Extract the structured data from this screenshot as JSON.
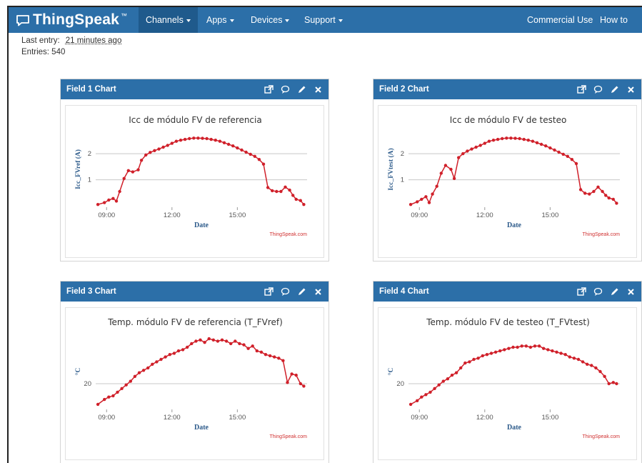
{
  "app": {
    "brand": "ThingSpeak",
    "brand_tm": "™",
    "nav": [
      {
        "label": "Channels",
        "dropdown": true,
        "active": true
      },
      {
        "label": "Apps",
        "dropdown": true
      },
      {
        "label": "Devices",
        "dropdown": true
      },
      {
        "label": "Support",
        "dropdown": true
      }
    ],
    "nav_right": [
      {
        "label": "Commercial Use"
      },
      {
        "label": "How to Buy"
      }
    ]
  },
  "meta": {
    "last_entry_label": "Last entry:",
    "last_entry_value": "21 minutes ago",
    "entries_label": "Entries: 540"
  },
  "colors": {
    "navbar": "#2c6fa8",
    "line": "#d0202a",
    "grid": "#c8c8c8",
    "axis_title": "#2c5a8a",
    "credit": "#d03030"
  },
  "icons": [
    "external-link-icon",
    "comment-icon",
    "pencil-icon",
    "close-icon"
  ],
  "panels": [
    {
      "title": "Field 1 Chart",
      "credit": "ThingSpeak.com"
    },
    {
      "title": "Field 2 Chart",
      "credit": "ThingSpeak.com"
    },
    {
      "title": "Field 3 Chart",
      "credit": "ThingSpeak.com"
    },
    {
      "title": "Field 4 Chart",
      "credit": "ThingSpeak.com"
    }
  ],
  "chart_data": [
    {
      "type": "line",
      "title": "Icc de módulo FV de referencia",
      "xlabel": "Date",
      "ylabel": "Icc_FVref (A)",
      "x_ticks": [
        "09:00",
        "12:00",
        "15:00"
      ],
      "y_ticks": [
        1,
        2
      ],
      "grid": true,
      "xlim": [
        8.5,
        18.2
      ],
      "ylim": [
        0,
        2.8
      ],
      "x": [
        8.6,
        8.9,
        9.1,
        9.3,
        9.45,
        9.6,
        9.8,
        10.0,
        10.2,
        10.45,
        10.6,
        10.8,
        11.0,
        11.2,
        11.4,
        11.6,
        11.8,
        12.0,
        12.2,
        12.4,
        12.6,
        12.8,
        13.0,
        13.2,
        13.4,
        13.6,
        13.8,
        14.0,
        14.2,
        14.4,
        14.6,
        14.8,
        15.0,
        15.2,
        15.4,
        15.6,
        15.8,
        16.0,
        16.2,
        16.4,
        16.6,
        16.8,
        17.0,
        17.2,
        17.4,
        17.55,
        17.7,
        17.9,
        18.05
      ],
      "y": [
        0.05,
        0.12,
        0.22,
        0.28,
        0.18,
        0.55,
        1.05,
        1.35,
        1.3,
        1.38,
        1.75,
        1.95,
        2.05,
        2.12,
        2.18,
        2.25,
        2.32,
        2.4,
        2.48,
        2.52,
        2.55,
        2.58,
        2.6,
        2.6,
        2.59,
        2.58,
        2.55,
        2.52,
        2.48,
        2.42,
        2.36,
        2.3,
        2.22,
        2.14,
        2.06,
        1.98,
        1.9,
        1.78,
        1.6,
        0.7,
        0.58,
        0.55,
        0.55,
        0.72,
        0.6,
        0.4,
        0.25,
        0.2,
        0.05
      ]
    },
    {
      "type": "line",
      "title": "Icc de módulo FV de testeo",
      "xlabel": "Date",
      "ylabel": "Icc_FVtest (A)",
      "x_ticks": [
        "09:00",
        "12:00",
        "15:00"
      ],
      "y_ticks": [
        1,
        2
      ],
      "grid": true,
      "xlim": [
        8.5,
        18.2
      ],
      "ylim": [
        0,
        2.8
      ],
      "x": [
        8.6,
        8.9,
        9.1,
        9.3,
        9.45,
        9.6,
        9.8,
        10.0,
        10.2,
        10.45,
        10.6,
        10.8,
        11.0,
        11.2,
        11.4,
        11.6,
        11.8,
        12.0,
        12.2,
        12.4,
        12.6,
        12.8,
        13.0,
        13.2,
        13.4,
        13.6,
        13.8,
        14.0,
        14.2,
        14.4,
        14.6,
        14.8,
        15.0,
        15.2,
        15.4,
        15.6,
        15.8,
        16.0,
        16.2,
        16.4,
        16.6,
        16.8,
        17.0,
        17.2,
        17.4,
        17.55,
        17.7,
        17.9,
        18.05
      ],
      "y": [
        0.05,
        0.15,
        0.25,
        0.35,
        0.12,
        0.45,
        0.75,
        1.25,
        1.55,
        1.4,
        1.05,
        1.85,
        2.0,
        2.1,
        2.18,
        2.25,
        2.32,
        2.4,
        2.48,
        2.52,
        2.55,
        2.58,
        2.6,
        2.6,
        2.59,
        2.58,
        2.55,
        2.52,
        2.48,
        2.42,
        2.36,
        2.3,
        2.22,
        2.14,
        2.06,
        1.98,
        1.9,
        1.78,
        1.62,
        0.62,
        0.48,
        0.45,
        0.55,
        0.72,
        0.55,
        0.4,
        0.3,
        0.25,
        0.1
      ]
    },
    {
      "type": "line",
      "title": "Temp. módulo FV de referencia (T_FVref)",
      "xlabel": "Date",
      "ylabel": "°C",
      "x_ticks": [
        "09:00",
        "12:00",
        "15:00"
      ],
      "y_ticks": [
        20
      ],
      "grid": true,
      "xlim": [
        8.5,
        18.2
      ],
      "ylim": [
        10,
        40
      ],
      "x": [
        8.6,
        8.9,
        9.1,
        9.3,
        9.5,
        9.7,
        9.9,
        10.1,
        10.3,
        10.5,
        10.7,
        10.9,
        11.1,
        11.3,
        11.5,
        11.7,
        11.9,
        12.1,
        12.3,
        12.5,
        12.7,
        12.9,
        13.1,
        13.3,
        13.5,
        13.7,
        13.9,
        14.1,
        14.3,
        14.5,
        14.7,
        14.9,
        15.1,
        15.3,
        15.5,
        15.7,
        15.9,
        16.1,
        16.3,
        16.5,
        16.7,
        16.9,
        17.1,
        17.3,
        17.5,
        17.7,
        17.9,
        18.05
      ],
      "y": [
        11.5,
        13.5,
        14.5,
        15.0,
        16.5,
        18.0,
        19.5,
        21.0,
        23.0,
        24.5,
        25.5,
        26.5,
        28.0,
        29.0,
        30.0,
        31.0,
        32.0,
        32.5,
        33.5,
        34.0,
        35.0,
        36.5,
        37.5,
        38.0,
        37.0,
        38.5,
        38.0,
        37.5,
        38.0,
        37.5,
        36.5,
        37.5,
        36.5,
        36.0,
        34.5,
        35.5,
        33.5,
        33.0,
        32.0,
        31.5,
        31.0,
        30.5,
        29.5,
        20.5,
        24.0,
        23.5,
        20.0,
        19.0
      ]
    },
    {
      "type": "line",
      "title": "Temp. módulo FV de testeo (T_FVtest)",
      "xlabel": "Date",
      "ylabel": "°C",
      "x_ticks": [
        "09:00",
        "12:00",
        "15:00"
      ],
      "y_ticks": [
        20
      ],
      "grid": true,
      "xlim": [
        8.5,
        18.2
      ],
      "ylim": [
        10,
        40
      ],
      "x": [
        8.6,
        8.9,
        9.1,
        9.3,
        9.5,
        9.7,
        9.9,
        10.1,
        10.3,
        10.5,
        10.7,
        10.9,
        11.1,
        11.3,
        11.5,
        11.7,
        11.9,
        12.1,
        12.3,
        12.5,
        12.7,
        12.9,
        13.1,
        13.3,
        13.5,
        13.7,
        13.9,
        14.1,
        14.3,
        14.5,
        14.7,
        14.9,
        15.1,
        15.3,
        15.5,
        15.7,
        15.9,
        16.1,
        16.3,
        16.5,
        16.7,
        16.9,
        17.1,
        17.3,
        17.5,
        17.7,
        17.9,
        18.05
      ],
      "y": [
        11.5,
        13.0,
        14.5,
        15.5,
        16.5,
        18.0,
        19.5,
        21.0,
        22.0,
        23.5,
        24.5,
        26.5,
        28.5,
        29.0,
        30.0,
        30.5,
        31.5,
        32.0,
        32.5,
        33.0,
        33.5,
        34.0,
        34.5,
        35.0,
        35.0,
        35.5,
        35.5,
        35.0,
        35.5,
        35.5,
        34.5,
        34.0,
        33.5,
        33.0,
        32.5,
        32.0,
        31.0,
        30.5,
        30.0,
        29.0,
        28.0,
        27.5,
        26.5,
        25.0,
        23.0,
        20.0,
        20.5,
        20.0
      ]
    }
  ]
}
